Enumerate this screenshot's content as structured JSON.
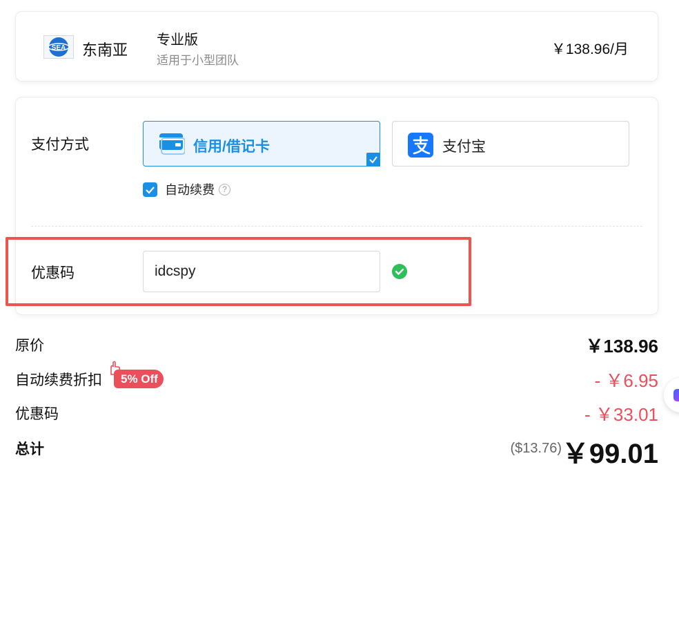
{
  "plan": {
    "region_name": "东南亚",
    "region_logo_text": "SEA",
    "name": "专业版",
    "description": "适用于小型团队",
    "price": "￥138.96/月"
  },
  "payment": {
    "label": "支付方式",
    "options": [
      {
        "label": "信用/借记卡",
        "icon": "credit-card-icon",
        "selected": true
      },
      {
        "label": "支付宝",
        "icon": "alipay-icon",
        "selected": false
      }
    ],
    "auto_renew": {
      "label": "自动续费",
      "checked": true
    },
    "help_icon_text": "?"
  },
  "coupon": {
    "label": "优惠码",
    "value": "idcspy",
    "status": "valid"
  },
  "summary": {
    "original_label": "原价",
    "original_value": "￥138.96",
    "renew_discount_label": "自动续费折扣",
    "renew_discount_badge": "5% Off",
    "renew_discount_value": "- ￥6.95",
    "coupon_label": "优惠码",
    "coupon_value": "- ￥33.01",
    "total_label": "总计",
    "total_usd": "($13.76)",
    "total_value": "￥99.01"
  },
  "colors": {
    "accent": "#1a8fe6",
    "discount_red": "#ec4f5c",
    "success_green": "#2fbf58",
    "highlight_red": "#ef5350"
  }
}
